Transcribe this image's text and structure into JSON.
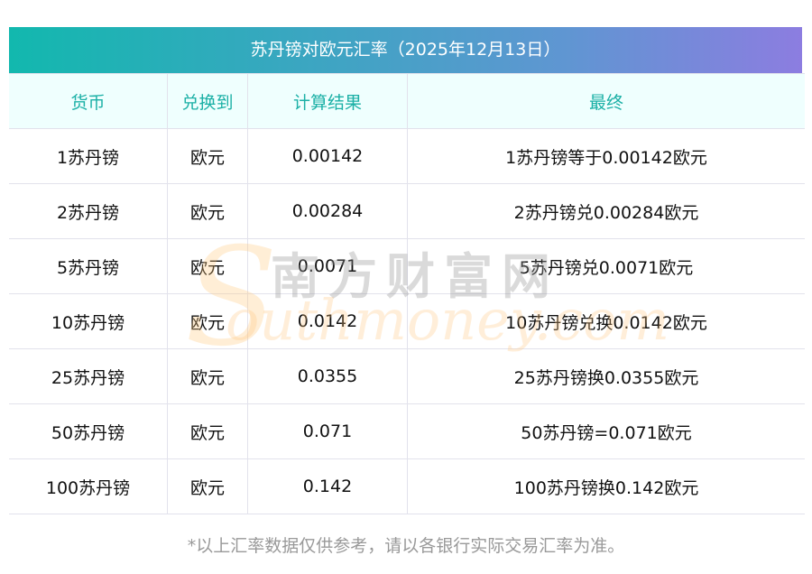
{
  "title": "苏丹镑对欧元汇率（2025年12月13日）",
  "headers": [
    "货币",
    "兑换到",
    "计算结果",
    "最终"
  ],
  "rows": [
    [
      "1苏丹镑",
      "欧元",
      "0.00142",
      "1苏丹镑等于0.00142欧元"
    ],
    [
      "2苏丹镑",
      "欧元",
      "0.00284",
      "2苏丹镑兑0.00284欧元"
    ],
    [
      "5苏丹镑",
      "欧元",
      "0.0071",
      "5苏丹镑兑0.0071欧元"
    ],
    [
      "10苏丹镑",
      "欧元",
      "0.0142",
      "10苏丹镑兑换0.0142欧元"
    ],
    [
      "25苏丹镑",
      "欧元",
      "0.0355",
      "25苏丹镑换0.0355欧元"
    ],
    [
      "50苏丹镑",
      "欧元",
      "0.071",
      "50苏丹镑=0.071欧元"
    ],
    [
      "100苏丹镑",
      "欧元",
      "0.142",
      "100苏丹镑换0.142欧元"
    ]
  ],
  "footer": "*以上汇率数据仅供参考，请以各银行实际交易汇率为准。",
  "watermark": {
    "cn": "南方财富网",
    "en": "Southmoney.com"
  }
}
